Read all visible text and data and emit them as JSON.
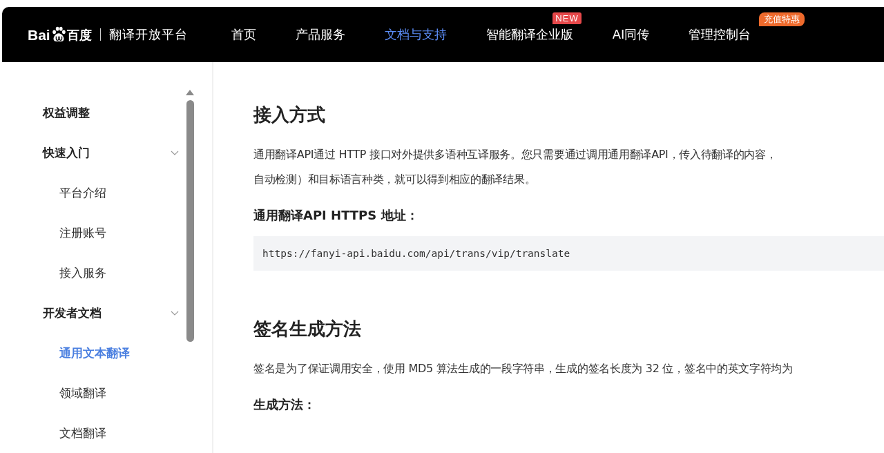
{
  "header": {
    "logo": {
      "brand": "Bai",
      "brand_cn": "百度",
      "product": "翻译开放平台"
    },
    "nav": [
      {
        "label": "首页",
        "selected": false
      },
      {
        "label": "产品服务",
        "selected": false
      },
      {
        "label": "文档与支持",
        "selected": true
      },
      {
        "label": "智能翻译企业版",
        "selected": false,
        "badge": {
          "text": "NEW",
          "kind": "new"
        }
      },
      {
        "label": "AI同传",
        "selected": false
      },
      {
        "label": "管理控制台",
        "selected": false,
        "badge": {
          "text": "充值特惠",
          "kind": "promo"
        }
      }
    ]
  },
  "sidebar": {
    "items": [
      {
        "label": "权益调整",
        "selected": false
      },
      {
        "label": "快速入门",
        "selected": false,
        "expanded": true,
        "children": [
          {
            "label": "平台介绍",
            "selected": false
          },
          {
            "label": "注册账号",
            "selected": false
          },
          {
            "label": "接入服务",
            "selected": false
          }
        ]
      },
      {
        "label": "开发者文档",
        "selected": false,
        "expanded": true,
        "children": [
          {
            "label": "通用文本翻译",
            "selected": true
          },
          {
            "label": "领域翻译",
            "selected": false
          },
          {
            "label": "文档翻译",
            "selected": false
          }
        ]
      }
    ]
  },
  "content": [
    {
      "kind": "h2",
      "text": "接入方式"
    },
    {
      "kind": "p",
      "lines": [
        "通用翻译API通过 HTTP 接口对外提供多语种互译服务。您只需要通过调用通用翻译API，传入待翻译的内容，",
        "自动检测）和目标语言种类，就可以得到相应的翻译结果。"
      ]
    },
    {
      "kind": "h3",
      "text": "通用翻译API HTTPS 地址："
    },
    {
      "kind": "code",
      "text": "https://fanyi-api.baidu.com/api/trans/vip/translate"
    },
    {
      "kind": "h2",
      "text": "签名生成方法"
    },
    {
      "kind": "p",
      "lines": [
        "签名是为了保证调用安全，使用 MD5 算法生成的一段字符串，生成的签名长度为 32 位，签名中的英文字符均为"
      ]
    },
    {
      "kind": "h3",
      "text": "生成方法："
    }
  ]
}
